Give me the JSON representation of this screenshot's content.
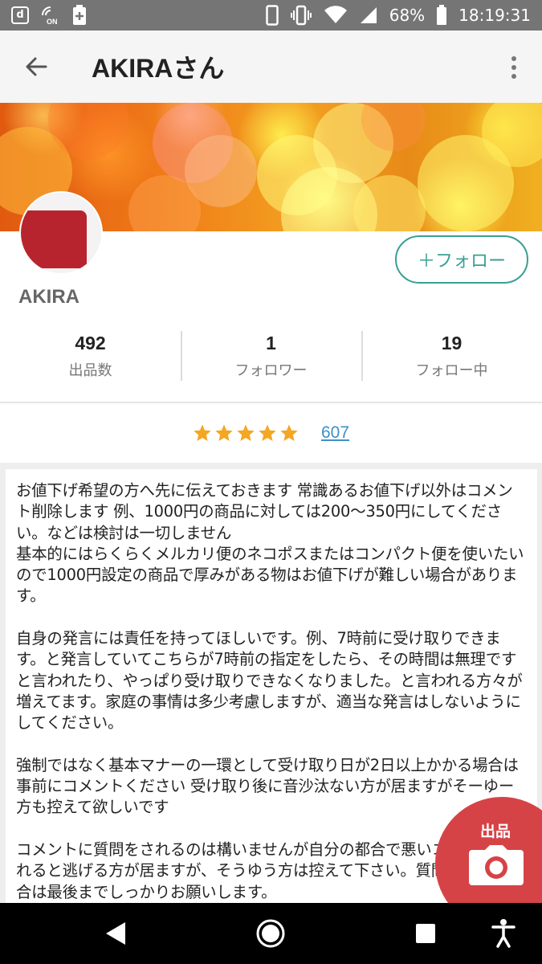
{
  "status_bar": {
    "battery": "68%",
    "time": "18:19:31",
    "icons": [
      "d-app-icon",
      "nfc-on-icon",
      "plus-box-icon",
      "phone-icon",
      "vibrate-icon",
      "wifi-icon",
      "signal-icon",
      "battery-icon"
    ],
    "nfc_label": "ON"
  },
  "app_bar": {
    "title": "AKIRAさん",
    "back_icon": "arrow-left-icon",
    "overflow_icon": "more-vert-icon"
  },
  "profile": {
    "username": "AKIRA",
    "follow_label": "＋フォロー"
  },
  "stats": [
    {
      "value": "492",
      "label": "出品数"
    },
    {
      "value": "1",
      "label": "フォロワー"
    },
    {
      "value": "19",
      "label": "フォロー中"
    }
  ],
  "rating": {
    "stars": 5,
    "count": "607",
    "star_color": "#f5a623"
  },
  "description": "お値下げ希望の方へ先に伝えておきます 常識あるお値下げ以外はコメント削除します 例、1000円の商品に対しては200〜350円にしてください。などは検討は一切しません\n基本的にはらくらくメルカリ便のネコポスまたはコンパクト便を使いたいので1000円設定の商品で厚みがある物はお値下げが難しい場合があります。\n\n自身の発言には責任を持ってほしいです。例、7時前に受け取りできます。と発言していてこちらが7時前の指定をしたら、その時間は無理ですと言われたり、やっぱり受け取りできなくなりました。と言われる方々が増えてます。家庭の事情は多少考慮しますが、適当な発言はしないようにしてください。\n\n強制ではなく基本マナーの一環として受け取り日が2日以上かかる場合は事前にコメントください 受け取り後に音沙汰ない方が居ますがそーゆー方も控えて欲しいです\n\nコメントに質問をされるのは構いませんが自分の都合で悪いコメントをされると逃げる方が居ますが、そうゆう方は控えて下さい。質問をされる場合は最後までしっかりお願いします。",
  "fab": {
    "label": "出品",
    "icon": "camera-icon",
    "color": "#d64347"
  },
  "nav_bar": {
    "icons": [
      "back-triangle-icon",
      "home-circle-icon",
      "recents-square-icon",
      "accessibility-icon"
    ]
  },
  "colors": {
    "accent": "#3a9f93",
    "link": "#3d8fc9"
  }
}
